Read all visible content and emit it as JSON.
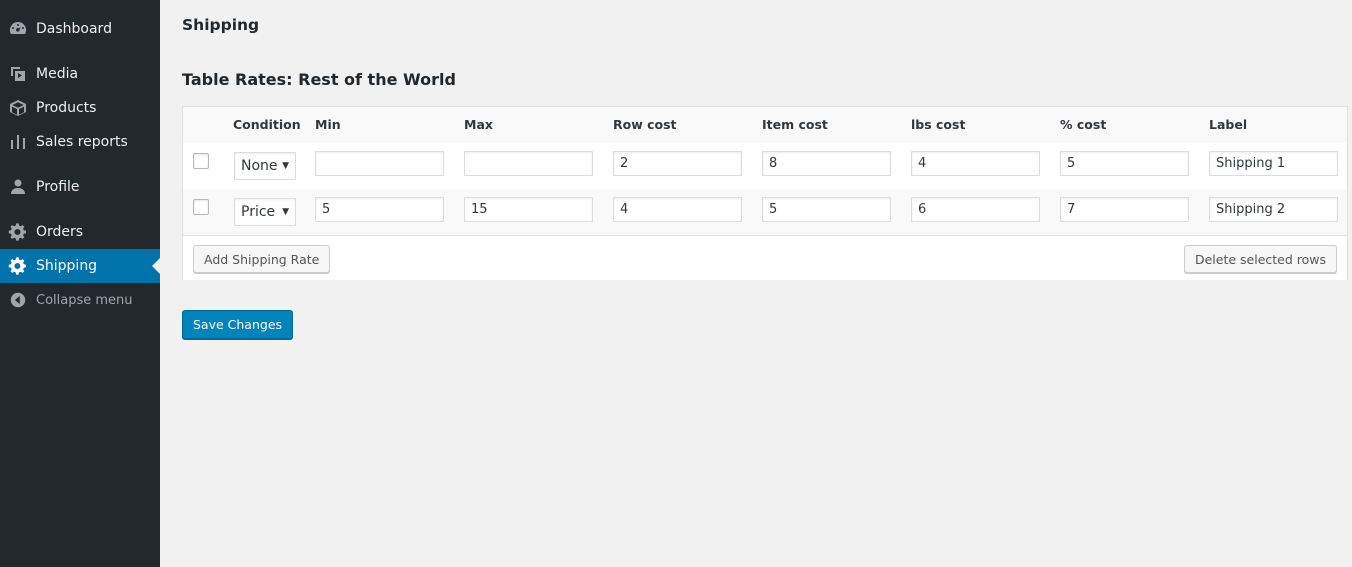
{
  "sidebar": {
    "items": [
      {
        "label": "Dashboard",
        "icon": "dashboard-icon"
      },
      {
        "label": "Media",
        "icon": "media-icon"
      },
      {
        "label": "Products",
        "icon": "products-icon"
      },
      {
        "label": "Sales reports",
        "icon": "chart-bar-icon"
      },
      {
        "label": "Profile",
        "icon": "user-icon"
      },
      {
        "label": "Orders",
        "icon": "gear-icon"
      },
      {
        "label": "Shipping",
        "icon": "gear-icon",
        "active": true
      },
      {
        "label": "Collapse menu",
        "icon": "collapse-arrow-icon"
      }
    ],
    "active_color": "#0073aa",
    "background_color": "#23282d"
  },
  "page": {
    "title": "Shipping",
    "section_title": "Table Rates: Rest of the World"
  },
  "table": {
    "columns": [
      "Condition",
      "Min",
      "Max",
      "Row cost",
      "Item cost",
      "lbs cost",
      "% cost",
      "Label"
    ],
    "rows": [
      {
        "condition": "None",
        "min": "",
        "max": "",
        "row_cost": "2",
        "item_cost": "8",
        "lbs_cost": "4",
        "pct_cost": "5",
        "label": "Shipping 1"
      },
      {
        "condition": "Price",
        "min": "5",
        "max": "15",
        "row_cost": "4",
        "item_cost": "5",
        "lbs_cost": "6",
        "pct_cost": "7",
        "label": "Shipping 2"
      }
    ],
    "add_button_label": "Add Shipping Rate",
    "delete_button_label": "Delete selected rows"
  },
  "save_button_label": "Save Changes",
  "primary_color": "#0085ba"
}
